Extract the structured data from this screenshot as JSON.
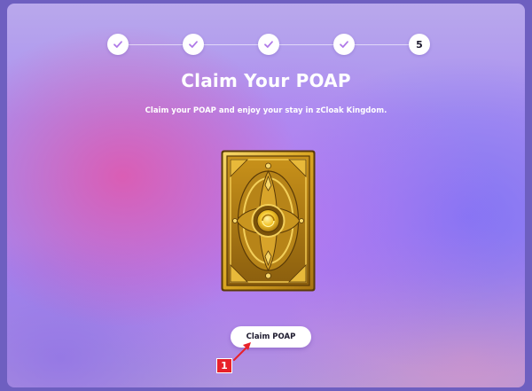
{
  "page": {
    "title": "Claim Your POAP",
    "subtitle": "Claim your POAP and enjoy your stay in zCloak Kingdom."
  },
  "stepper": {
    "steps": [
      {
        "state": "done",
        "icon": "check-icon"
      },
      {
        "state": "done",
        "icon": "check-icon"
      },
      {
        "state": "done",
        "icon": "check-icon"
      },
      {
        "state": "done",
        "icon": "check-icon"
      },
      {
        "state": "current",
        "label": "5"
      }
    ],
    "check_color": "#b07ae8"
  },
  "poap": {
    "icon": "golden-card-icon"
  },
  "actions": {
    "claim_label": "Claim POAP"
  },
  "annotation": {
    "marker_label": "1",
    "color": "#e8212a"
  }
}
